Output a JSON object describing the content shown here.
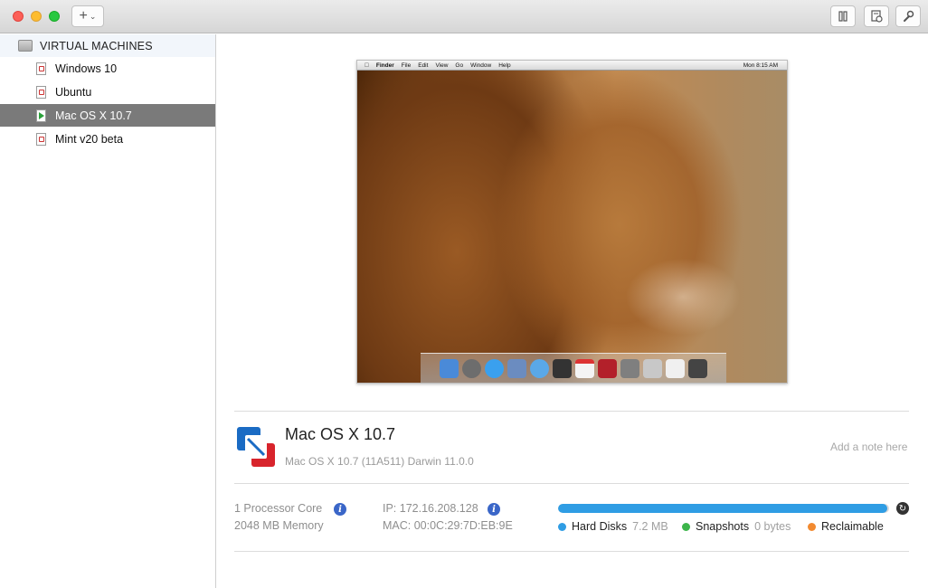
{
  "toolbar": {
    "add_label": "+",
    "add_chevron": "⌄"
  },
  "sidebar": {
    "header": "VIRTUAL MACHINES",
    "items": [
      {
        "label": "Windows 10"
      },
      {
        "label": "Ubuntu"
      },
      {
        "label": "Mac OS X 10.7"
      },
      {
        "label": "Mint v20 beta"
      }
    ]
  },
  "guest": {
    "menu": [
      "Finder",
      "File",
      "Edit",
      "View",
      "Go",
      "Window",
      "Help"
    ],
    "clock": "Mon 8:15 AM"
  },
  "vm": {
    "name": "Mac OS X 10.7",
    "subtitle": "Mac OS X 10.7 (11A511) Darwin 11.0.0",
    "note_placeholder": "Add a note here",
    "processor": "1 Processor Core",
    "memory": "2048 MB Memory",
    "ip": "IP: 172.16.208.128",
    "mac": "MAC: 00:0C:29:7D:EB:9E"
  },
  "storage": {
    "hard_disks_fraction": 0.995,
    "legend": [
      {
        "name": "Hard Disks",
        "value": "7.2 MB",
        "color": "#2f9de4"
      },
      {
        "name": "Snapshots",
        "value": "0 bytes",
        "color": "#3cb54a"
      },
      {
        "name": "Reclaimable",
        "value": "",
        "color": "#f28a30"
      }
    ]
  },
  "colors": {
    "selection": "#7a7a7a",
    "accent": "#2f9de4"
  }
}
